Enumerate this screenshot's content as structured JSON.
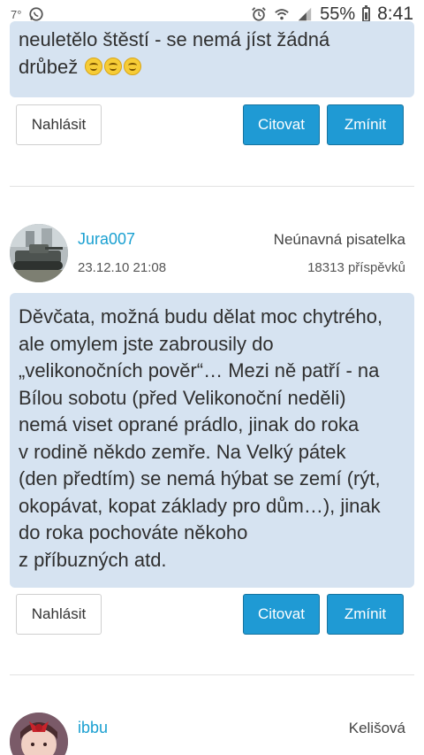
{
  "status_bar": {
    "small_indicator": "7°",
    "battery_percent": "55%",
    "time": "8:41",
    "icons": [
      "whatsapp-icon",
      "alarm-icon",
      "wifi-icon",
      "signal-icon",
      "battery-icon"
    ]
  },
  "colors": {
    "bubble_bg": "#d6e3f1",
    "accent_button": "#1f9ad4",
    "username_link": "#1aa0d1"
  },
  "post_prev": {
    "text_lines": [
      "neuletělo štěstí - se nemá jíst žádná",
      "drůbež"
    ],
    "emojis": [
      "smiling-face-icon",
      "smiling-face-icon",
      "smiling-face-icon"
    ],
    "actions": {
      "report": "Nahlásit",
      "quote": "Citovat",
      "mention": "Zmínit"
    }
  },
  "post_jura": {
    "username": "Jura007",
    "rank": "Neúnavná pisatelka",
    "date": "23.12.10 21:08",
    "post_count": "18313 příspěvků",
    "body_lines": [
      "Děvčata, možná budu dělat moc chytrého,",
      "ale omylem jste zabrousily do",
      "„velikonočních pověr“… Mezi ně patří - na",
      "Bílou sobotu (před Velikonoční neděli)",
      "nemá viset oprané prádlo, jinak do roka",
      "v rodině někdo zemře. Na Velký pátek",
      "(den předtím) se nemá hýbat se zemí (rýt,",
      "okopávat, kopat základy pro dům…), jinak",
      "do roka pochováte někoho",
      "z příbuzných atd."
    ],
    "actions": {
      "report": "Nahlásit",
      "quote": "Citovat",
      "mention": "Zmínit"
    }
  },
  "post_ibbu": {
    "username": "ibbu",
    "rank": "Kelišová"
  }
}
